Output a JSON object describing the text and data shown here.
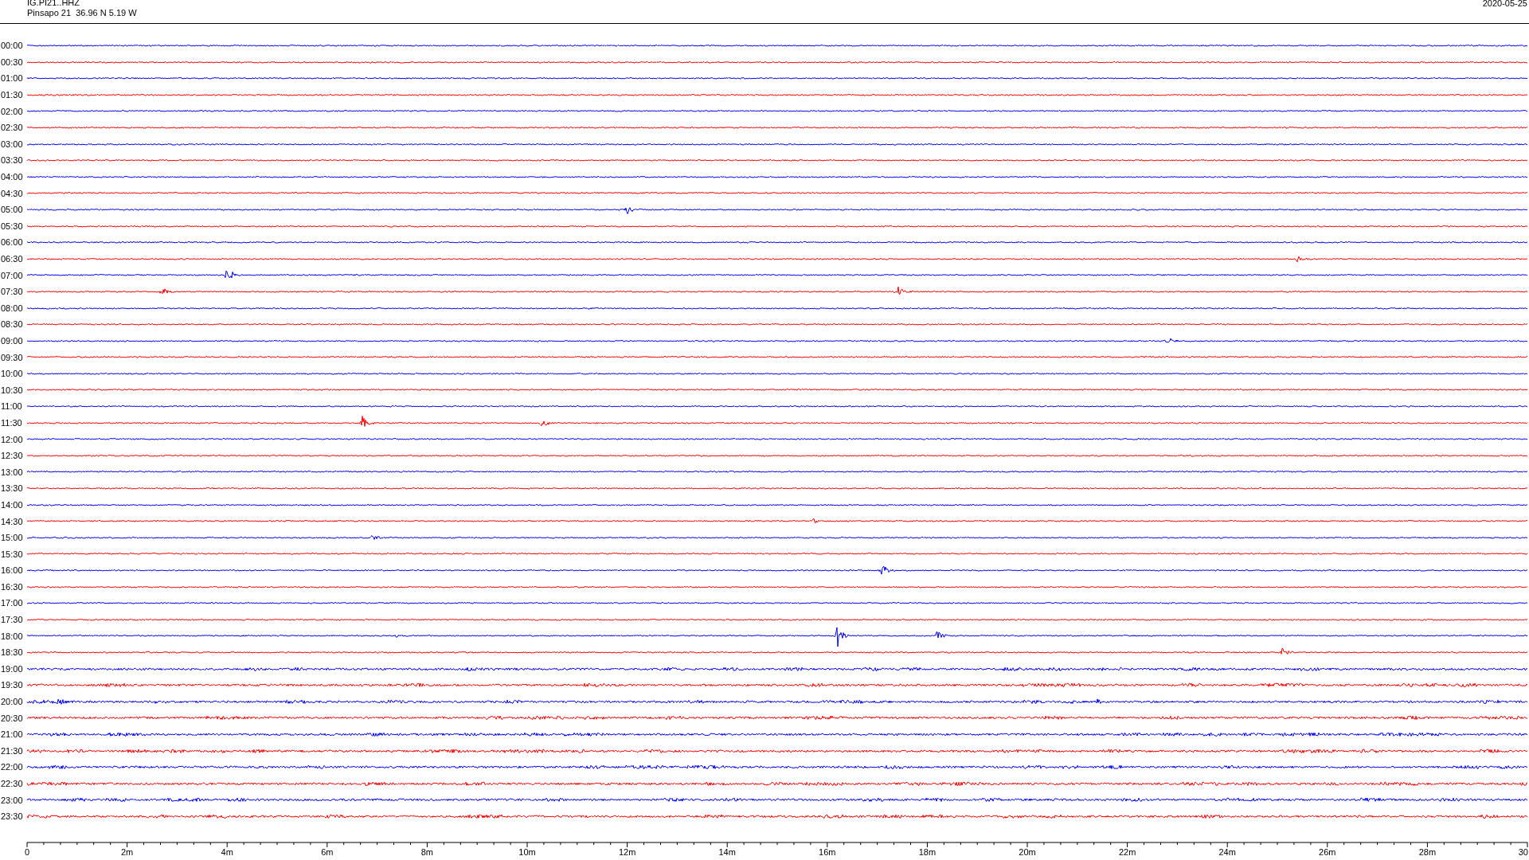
{
  "header": {
    "channel": "IG.PI21..HHZ",
    "station": "Pinsapo 21  36.96 N 5.19 W",
    "date": "2020-05-25"
  },
  "rows": [
    {
      "label": "00:00",
      "color": "#0000ff"
    },
    {
      "label": "00:30",
      "color": "#ff0000"
    },
    {
      "label": "01:00",
      "color": "#0000ff"
    },
    {
      "label": "01:30",
      "color": "#ff0000"
    },
    {
      "label": "02:00",
      "color": "#0000ff"
    },
    {
      "label": "02:30",
      "color": "#ff0000"
    },
    {
      "label": "03:00",
      "color": "#0000ff"
    },
    {
      "label": "03:30",
      "color": "#ff0000"
    },
    {
      "label": "04:00",
      "color": "#0000ff"
    },
    {
      "label": "04:30",
      "color": "#ff0000"
    },
    {
      "label": "05:00",
      "color": "#0000ff"
    },
    {
      "label": "05:30",
      "color": "#ff0000"
    },
    {
      "label": "06:00",
      "color": "#0000ff"
    },
    {
      "label": "06:30",
      "color": "#ff0000"
    },
    {
      "label": "07:00",
      "color": "#0000ff"
    },
    {
      "label": "07:30",
      "color": "#ff0000"
    },
    {
      "label": "08:00",
      "color": "#0000ff"
    },
    {
      "label": "08:30",
      "color": "#ff0000"
    },
    {
      "label": "09:00",
      "color": "#0000ff"
    },
    {
      "label": "09:30",
      "color": "#ff0000"
    },
    {
      "label": "10:00",
      "color": "#0000ff"
    },
    {
      "label": "10:30",
      "color": "#ff0000"
    },
    {
      "label": "11:00",
      "color": "#0000ff"
    },
    {
      "label": "11:30",
      "color": "#ff0000"
    },
    {
      "label": "12:00",
      "color": "#0000ff"
    },
    {
      "label": "12:30",
      "color": "#ff0000"
    },
    {
      "label": "13:00",
      "color": "#0000ff"
    },
    {
      "label": "13:30",
      "color": "#ff0000"
    },
    {
      "label": "14:00",
      "color": "#0000ff"
    },
    {
      "label": "14:30",
      "color": "#ff0000"
    },
    {
      "label": "15:00",
      "color": "#0000ff"
    },
    {
      "label": "15:30",
      "color": "#ff0000"
    },
    {
      "label": "16:00",
      "color": "#0000ff"
    },
    {
      "label": "16:30",
      "color": "#ff0000"
    },
    {
      "label": "17:00",
      "color": "#0000ff"
    },
    {
      "label": "17:30",
      "color": "#ff0000"
    },
    {
      "label": "18:00",
      "color": "#0000ff"
    },
    {
      "label": "18:30",
      "color": "#ff0000"
    },
    {
      "label": "19:00",
      "color": "#0000ff"
    },
    {
      "label": "19:30",
      "color": "#ff0000"
    },
    {
      "label": "20:00",
      "color": "#0000ff"
    },
    {
      "label": "20:30",
      "color": "#ff0000"
    },
    {
      "label": "21:00",
      "color": "#0000ff"
    },
    {
      "label": "21:30",
      "color": "#ff0000"
    },
    {
      "label": "22:00",
      "color": "#0000ff"
    },
    {
      "label": "22:30",
      "color": "#ff0000"
    },
    {
      "label": "23:00",
      "color": "#0000ff"
    },
    {
      "label": "23:30",
      "color": "#ff0000"
    }
  ],
  "time_axis": {
    "labels": [
      "0",
      "2m",
      "4m",
      "6m",
      "8m",
      "10m",
      "12m",
      "14m",
      "16m",
      "18m",
      "20m",
      "22m",
      "24m",
      "26m",
      "28m",
      "30"
    ]
  }
}
